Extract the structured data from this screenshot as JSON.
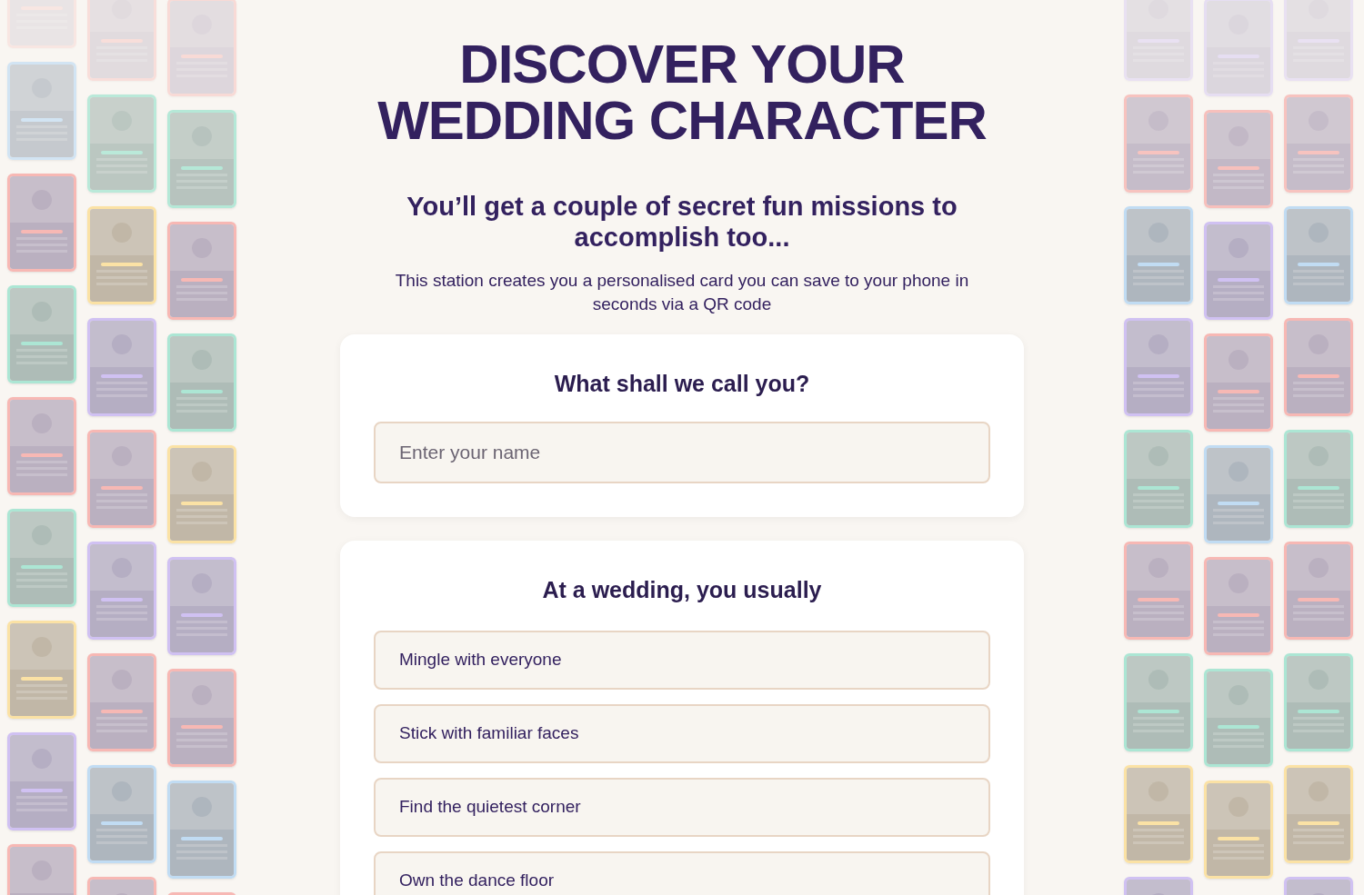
{
  "title": [
    "DISCOVER YOUR",
    "WEDDING CHARACTER"
  ],
  "subtitle": "You’ll get a couple of secret fun missions to accomplish too...",
  "intro": "This station creates you a personalised card you can save to your phone in seconds via a QR code",
  "name_card": {
    "heading": "What shall we call you?",
    "placeholder": "Enter your name"
  },
  "question_card": {
    "heading": "At a wedding, you usually",
    "options": [
      {
        "label": "Mingle with everyone",
        "selected": false
      },
      {
        "label": "Stick with familiar faces",
        "selected": false
      },
      {
        "label": "Find the quietest corner",
        "selected": false
      },
      {
        "label": "Own the dance floor",
        "selected": false
      }
    ]
  }
}
